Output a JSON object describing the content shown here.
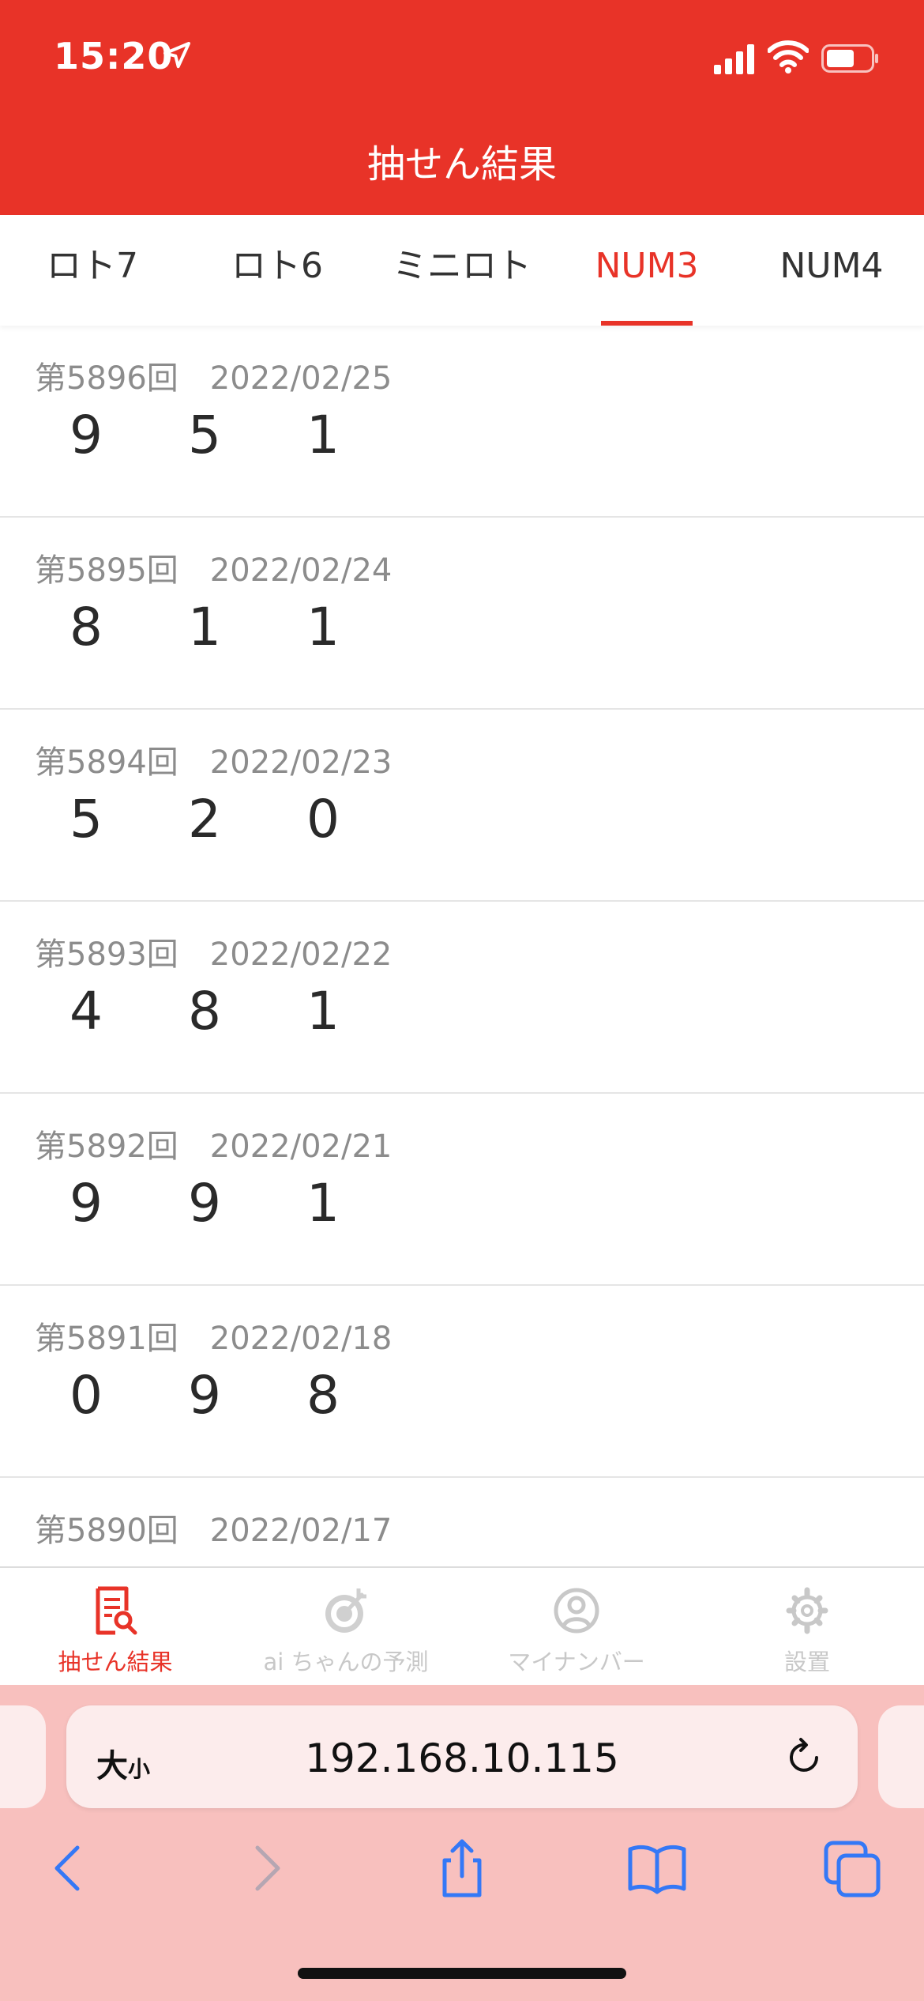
{
  "status_bar": {
    "time": "15:20"
  },
  "header": {
    "title": "抽せん結果"
  },
  "tabs": [
    {
      "label": "ロト7"
    },
    {
      "label": "ロト6"
    },
    {
      "label": "ミニロト"
    },
    {
      "label": "NUM3",
      "active": true
    },
    {
      "label": "NUM4"
    }
  ],
  "results": [
    {
      "round": "第5896回",
      "date": "2022/02/25",
      "numbers": [
        "9",
        "5",
        "1"
      ]
    },
    {
      "round": "第5895回",
      "date": "2022/02/24",
      "numbers": [
        "8",
        "1",
        "1"
      ]
    },
    {
      "round": "第5894回",
      "date": "2022/02/23",
      "numbers": [
        "5",
        "2",
        "0"
      ]
    },
    {
      "round": "第5893回",
      "date": "2022/02/22",
      "numbers": [
        "4",
        "8",
        "1"
      ]
    },
    {
      "round": "第5892回",
      "date": "2022/02/21",
      "numbers": [
        "9",
        "9",
        "1"
      ]
    },
    {
      "round": "第5891回",
      "date": "2022/02/18",
      "numbers": [
        "0",
        "9",
        "8"
      ]
    },
    {
      "round": "第5890回",
      "date": "2022/02/17",
      "numbers": [
        "",
        "",
        ""
      ]
    }
  ],
  "tabbar": [
    {
      "label": "抽せん結果",
      "icon": "results-search-icon",
      "active": true
    },
    {
      "label": "ai ちゃんの予測",
      "icon": "target-icon"
    },
    {
      "label": "マイナンバー",
      "icon": "user-circle-icon"
    },
    {
      "label": "設置",
      "icon": "gear-icon"
    }
  ],
  "browser": {
    "text_size_label_big": "大",
    "text_size_label_small": "小",
    "url": "192.168.10.115"
  },
  "colors": {
    "accent": "#e83328",
    "browser_bar": "#f8c0be",
    "ios_blue": "#3478f6"
  }
}
